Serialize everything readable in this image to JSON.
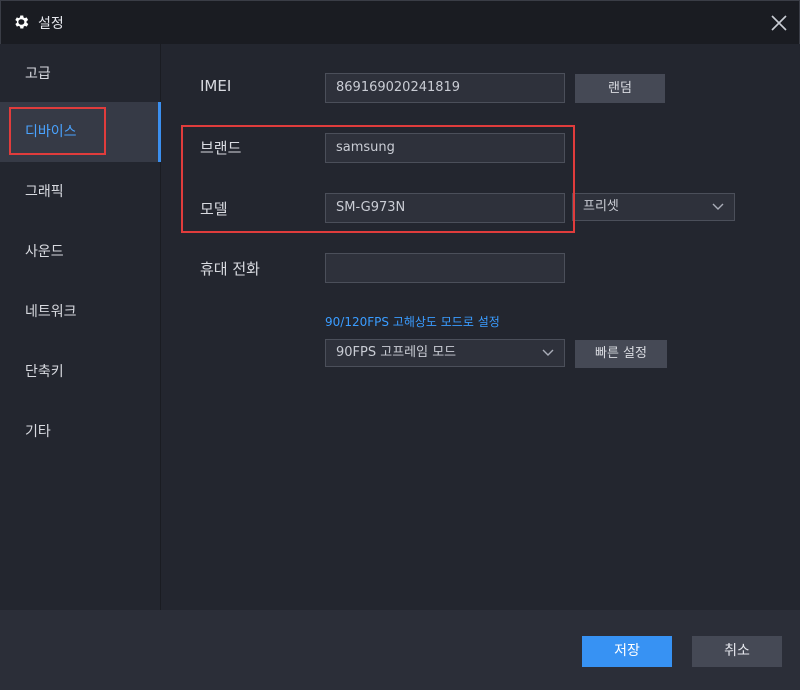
{
  "window": {
    "title": "설정",
    "icon": "gear-icon",
    "close_icon": "close-icon"
  },
  "sidebar": {
    "items": [
      {
        "label": "고급"
      },
      {
        "label": "디바이스",
        "active": true
      },
      {
        "label": "그래픽"
      },
      {
        "label": "사운드"
      },
      {
        "label": "네트워크"
      },
      {
        "label": "단축키"
      },
      {
        "label": "기타"
      }
    ]
  },
  "device": {
    "imei_label": "IMEI",
    "imei_value": "869169020241819",
    "random_button": "랜덤",
    "brand_label": "브랜드",
    "brand_value": "samsung",
    "model_label": "모델",
    "model_value": "SM-G973N",
    "preset_select": "프리셋",
    "phone_label": "휴대 전화",
    "phone_value": "",
    "fps_link": "90/120FPS 고해상도 모드로 설정",
    "fps_select": "90FPS 고프레임 모드",
    "quick_setup_button": "빠른 설정"
  },
  "footer": {
    "save": "저장",
    "cancel": "취소"
  },
  "colors": {
    "accent": "#3792f3",
    "highlight": "#e03c3c",
    "background": "#23262f",
    "titlebar": "#1a1c22"
  }
}
